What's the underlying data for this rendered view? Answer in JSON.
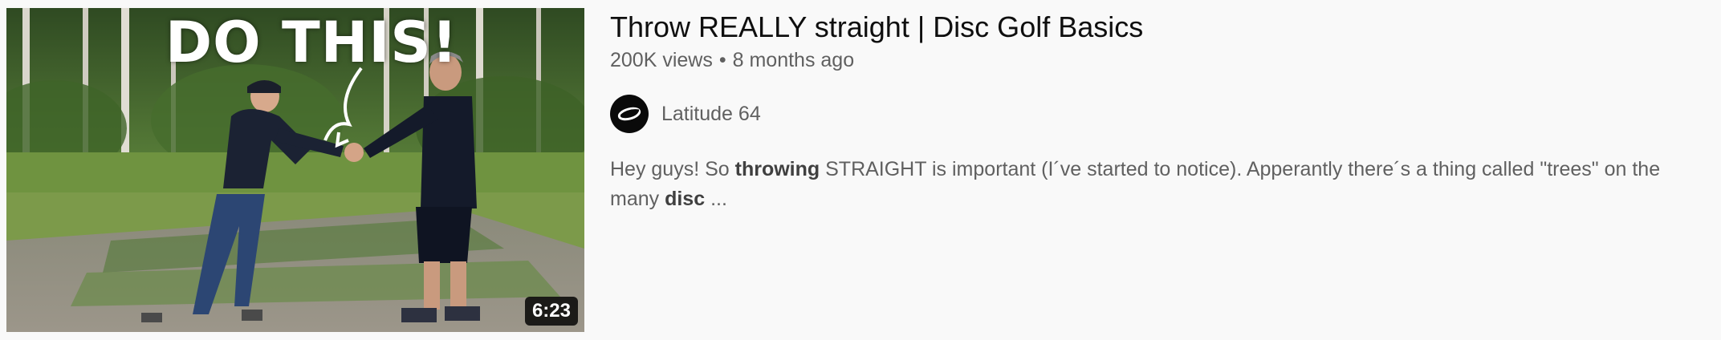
{
  "video": {
    "thumbnail_text": "DO THIS!",
    "duration": "6:23",
    "title": "Throw REALLY straight | Disc Golf Basics",
    "views": "200K views",
    "separator": "•",
    "published": "8 months ago"
  },
  "channel": {
    "name": "Latitude 64",
    "avatar_icon": "latitude64-logo-icon",
    "avatar_color": "#0a0a0a"
  },
  "description": {
    "line1": {
      "t1": "Hey guys! So ",
      "b1": "throwing",
      "t2": " STRAIGHT is important (I´ve started to notice). Apperantly there´s a thing called \"trees\" on the"
    },
    "line2": {
      "t1": "many ",
      "b1": "disc",
      "t2": " ..."
    }
  },
  "colors": {
    "background": "#f9f9f9",
    "title": "#0f0f0f",
    "secondary_text": "#606060"
  }
}
